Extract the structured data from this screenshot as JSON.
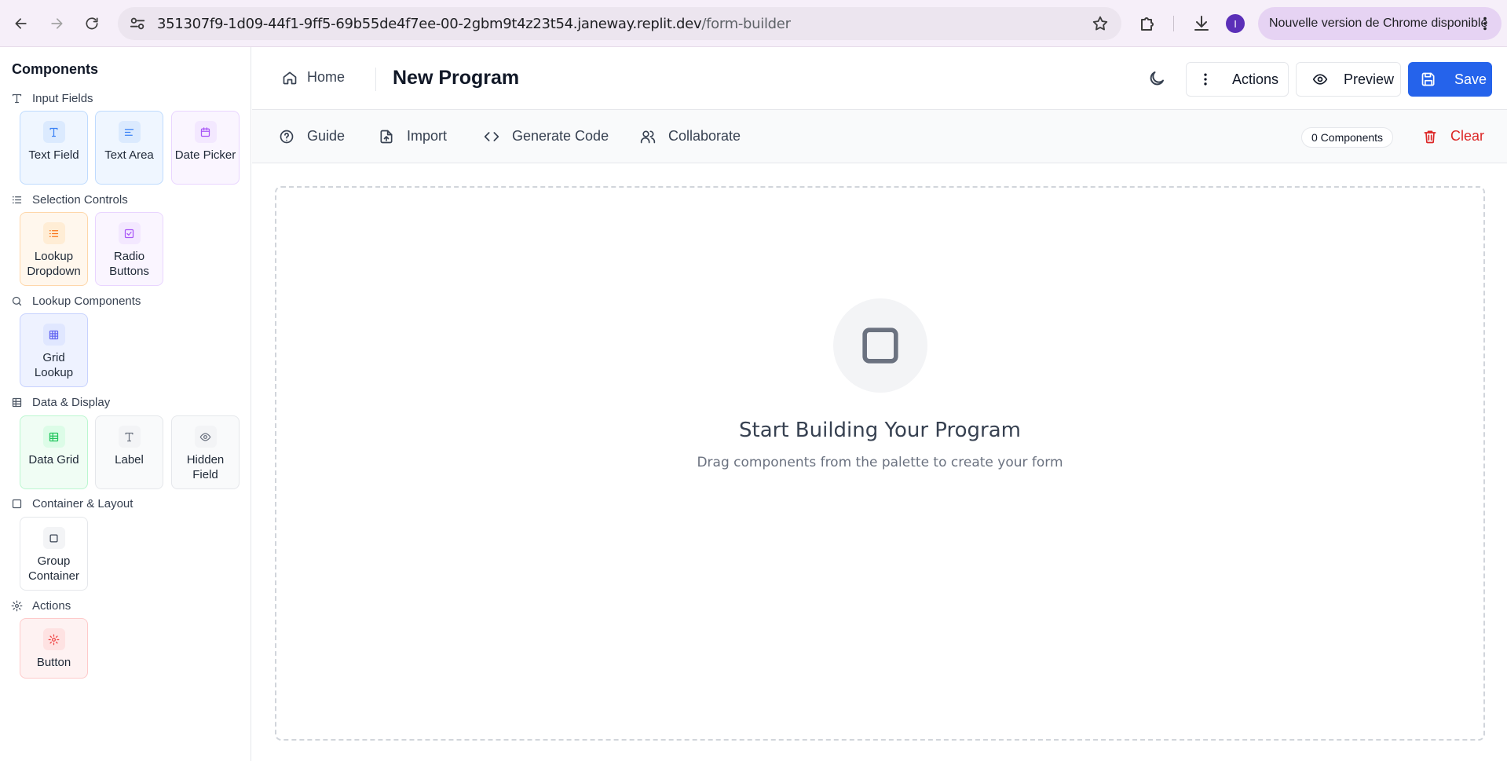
{
  "browser": {
    "url_host": "351307f9-1d09-44f1-9ff5-69b55de4f7ee-00-2gbm9t4z23t54.janeway.replit.dev",
    "url_path": "/form-builder",
    "profile_initial": "I",
    "update_text": "Nouvelle version de Chrome disponible"
  },
  "sidebar": {
    "title": "Components",
    "groups": [
      {
        "label": "Input Fields",
        "icon": "type-icon",
        "items": [
          {
            "label": "Text Field",
            "icon": "type-icon",
            "color": "blue"
          },
          {
            "label": "Text Area",
            "icon": "align-left-icon",
            "color": "blue"
          },
          {
            "label": "Date Picker",
            "icon": "calendar-icon",
            "color": "purple"
          }
        ]
      },
      {
        "label": "Selection Controls",
        "icon": "list-icon",
        "items": [
          {
            "label": "Lookup Dropdown",
            "icon": "list-icon",
            "color": "orange"
          },
          {
            "label": "Radio Buttons",
            "icon": "check-square-icon",
            "color": "purple"
          }
        ]
      },
      {
        "label": "Lookup Components",
        "icon": "search-icon",
        "items": [
          {
            "label": "Grid Lookup",
            "icon": "grid-icon",
            "color": "indigo"
          }
        ]
      },
      {
        "label": "Data & Display",
        "icon": "table-icon",
        "items": [
          {
            "label": "Data Grid",
            "icon": "table-icon",
            "color": "green"
          },
          {
            "label": "Label",
            "icon": "type-icon",
            "color": "gray"
          },
          {
            "label": "Hidden Field",
            "icon": "eye-icon",
            "color": "gray"
          }
        ]
      },
      {
        "label": "Container & Layout",
        "icon": "square-icon",
        "items": [
          {
            "label": "Group Container",
            "icon": "square-icon",
            "color": "white"
          }
        ]
      },
      {
        "label": "Actions",
        "icon": "settings-icon",
        "items": [
          {
            "label": "Button",
            "icon": "settings-icon",
            "color": "red"
          }
        ]
      }
    ]
  },
  "header": {
    "home_label": "Home",
    "title": "New Program",
    "actions_label": "Actions",
    "preview_label": "Preview",
    "save_label": "Save"
  },
  "toolbar": {
    "guide_label": "Guide",
    "import_label": "Import",
    "generate_code_label": "Generate Code",
    "collaborate_label": "Collaborate",
    "component_count": "0 Components",
    "clear_label": "Clear"
  },
  "canvas": {
    "empty_title": "Start Building Your Program",
    "empty_subtitle": "Drag components from the palette to create your form"
  },
  "colors": {
    "primary": "#2563eb",
    "danger": "#dc2626",
    "chrome_bg": "#f6eff9"
  }
}
